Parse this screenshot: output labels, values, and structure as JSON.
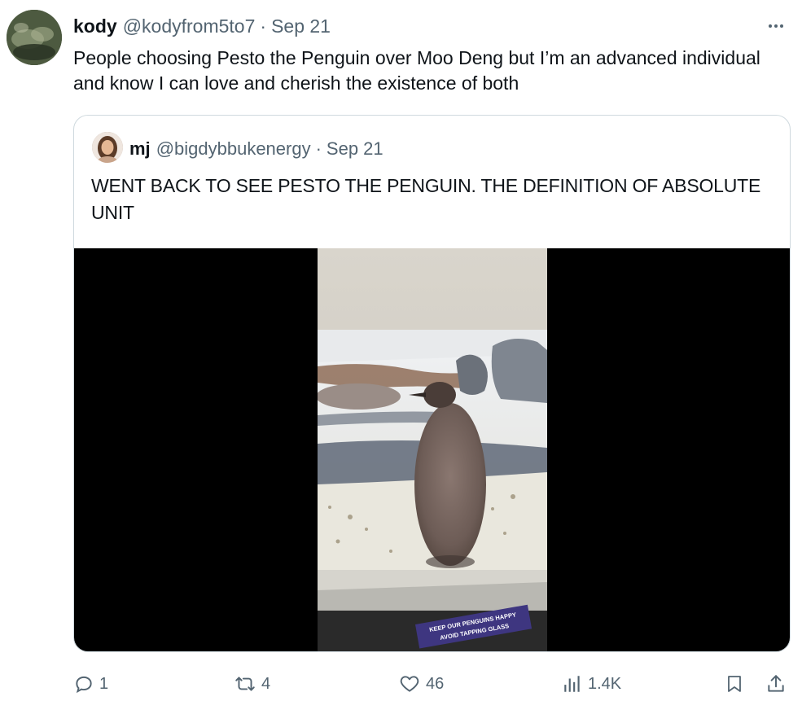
{
  "tweet": {
    "display_name": "kody",
    "handle": "@kodyfrom5to7",
    "separator": "·",
    "date": "Sep 21",
    "text": "People choosing Pesto the Penguin over Moo Deng but I’m an advanced individual and know I can love and cherish the existence of both"
  },
  "quoted": {
    "display_name": "mj",
    "handle": "@bigdybbukenergy",
    "separator": "·",
    "date": "Sep 21",
    "text": "WENT BACK TO SEE PESTO THE PENGUIN. THE DEFINITION OF ABSOLUTE UNIT",
    "media": {
      "sign_line1": "KEEP OUR PENGUINS HAPPY",
      "sign_line2": "AVOID TAPPING GLASS"
    }
  },
  "actions": {
    "replies": "1",
    "reposts": "4",
    "likes": "46",
    "views": "1.4K"
  },
  "icons": {
    "more": "more-icon",
    "reply": "reply-icon",
    "repost": "repost-icon",
    "like": "heart-icon",
    "views": "views-icon",
    "bookmark": "bookmark-icon",
    "share": "share-icon"
  },
  "colors": {
    "text": "#0f1419",
    "muted": "#536471",
    "border": "#cfd9de"
  }
}
